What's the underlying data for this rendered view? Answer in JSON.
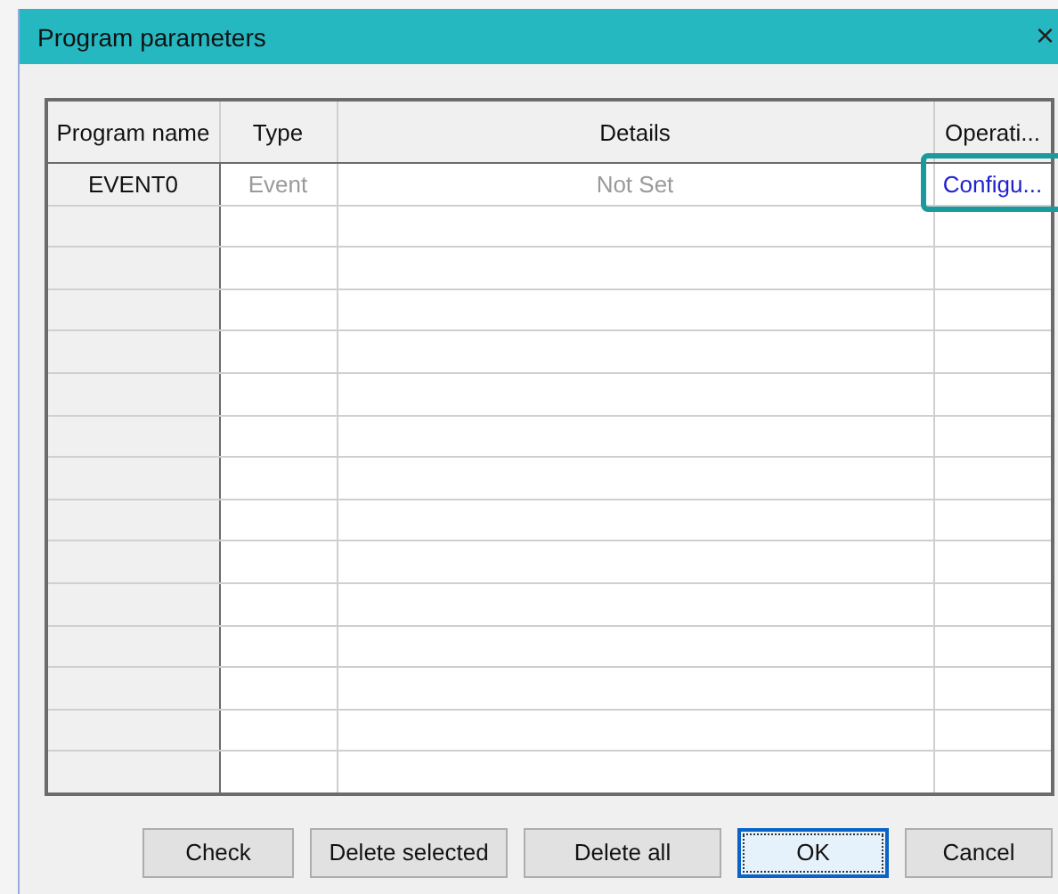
{
  "window": {
    "title": "Program parameters",
    "close": "×"
  },
  "table": {
    "columns": [
      "Program name",
      "Type",
      "Details",
      "Operati..."
    ],
    "rows": [
      {
        "program_name": "EVENT0",
        "type": "Event",
        "details": "Not Set",
        "operation": "Configu...",
        "highlighted": true
      },
      {},
      {},
      {},
      {},
      {},
      {},
      {},
      {},
      {},
      {},
      {},
      {},
      {},
      {}
    ]
  },
  "buttons": [
    {
      "label": "Check",
      "default": false
    },
    {
      "label": "Delete selected",
      "default": false
    },
    {
      "label": "Delete all",
      "default": false
    },
    {
      "label": "OK",
      "default": true
    },
    {
      "label": "Cancel",
      "default": false
    }
  ]
}
